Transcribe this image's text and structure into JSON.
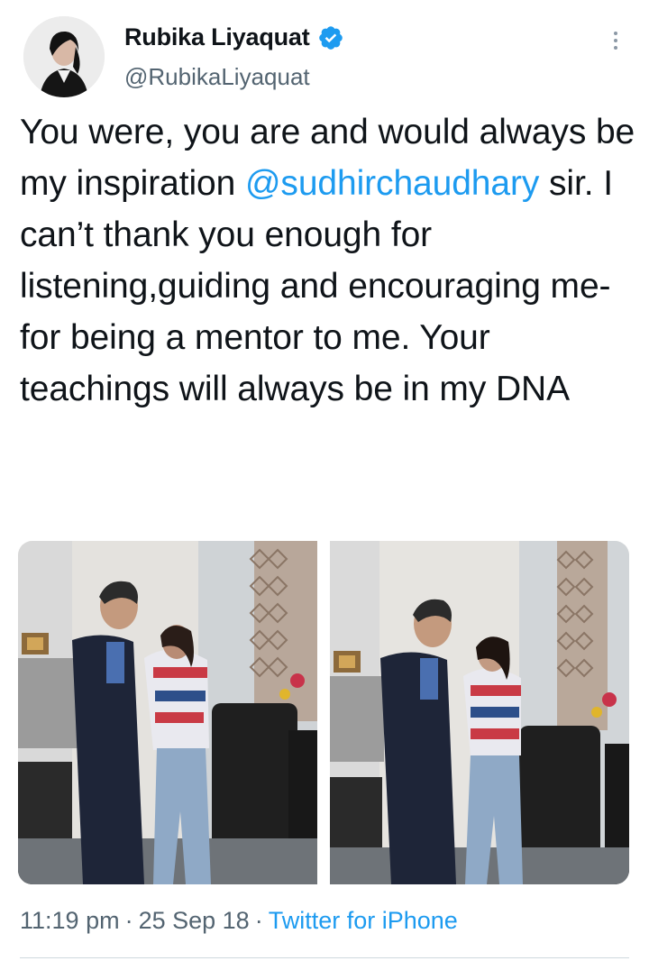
{
  "author": {
    "display_name": "Rubika Liyaquat",
    "handle": "@RubikaLiyaquat",
    "verified": true,
    "avatar_icon": "profile-photo"
  },
  "tweet": {
    "text_before": "You were, you are and would always be my inspiration ",
    "mention": "@sudhirchaudhary",
    "text_after": " sir. I can’t thank you enough for listening,guiding and encouraging me-for being a mentor to me. Your teachings will always be in my DNA",
    "photos": [
      "photo-1",
      "photo-2"
    ]
  },
  "meta": {
    "time": "11:19 pm",
    "separator": "·",
    "date": "25 Sep 18",
    "source": "Twitter for iPhone"
  },
  "colors": {
    "link": "#1d9bf0",
    "secondary_text": "#536471",
    "verified_badge": "#1d9bf0"
  }
}
